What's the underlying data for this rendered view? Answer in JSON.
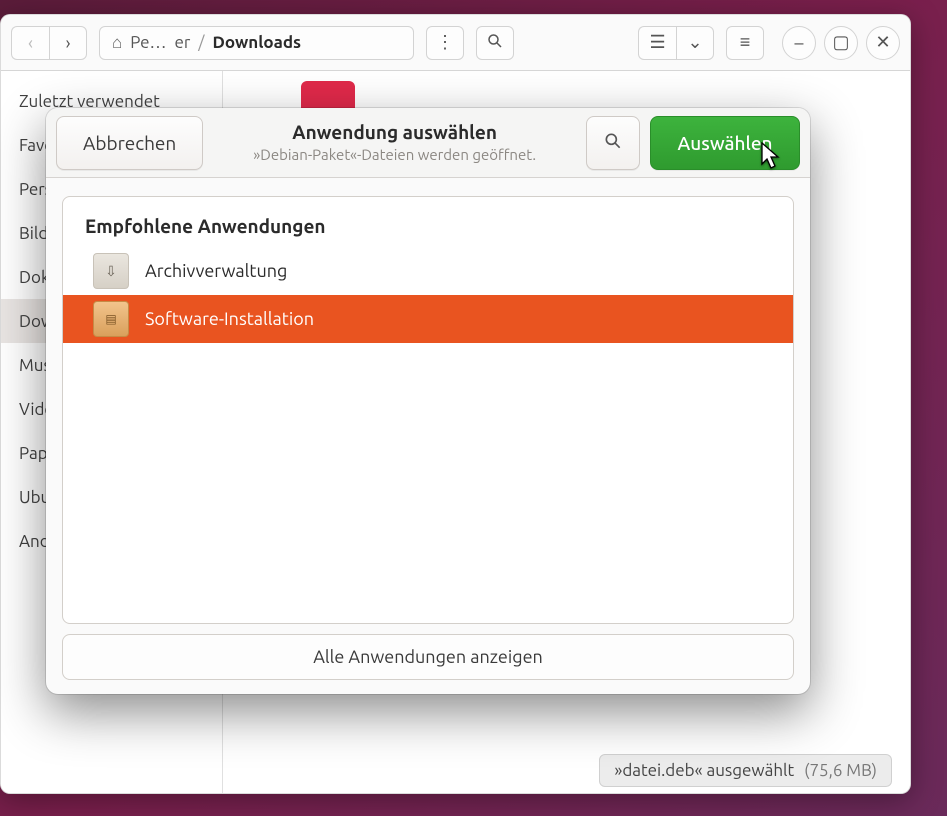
{
  "window": {
    "path": {
      "home_label": "Pe…",
      "home_suffix": "er",
      "current": "Downloads"
    },
    "sidebar": [
      "Zuletzt verwendet",
      "Favoriten",
      "Persönlicher Ordner",
      "Bilder",
      "Dokumente",
      "Downloads",
      "Musik",
      "Videos",
      "Papierkorb",
      "Ubuntu",
      "Andere Orte"
    ],
    "sidebar_selected_index": 5,
    "status": {
      "text": "»datei.deb« ausgewählt",
      "size": "(75,6 MB)"
    }
  },
  "dialog": {
    "cancel": "Abbrechen",
    "title": "Anwendung auswählen",
    "subtitle": "»Debian-Paket«-Dateien werden geöffnet.",
    "select": "Auswählen",
    "recommended_header": "Empfohlene Anwendungen",
    "apps": [
      {
        "name": "Archivverwaltung",
        "icon": "archive",
        "selected": false
      },
      {
        "name": "Software-Installation",
        "icon": "pkg",
        "selected": true
      }
    ],
    "all_apps": "Alle Anwendungen anzeigen"
  }
}
